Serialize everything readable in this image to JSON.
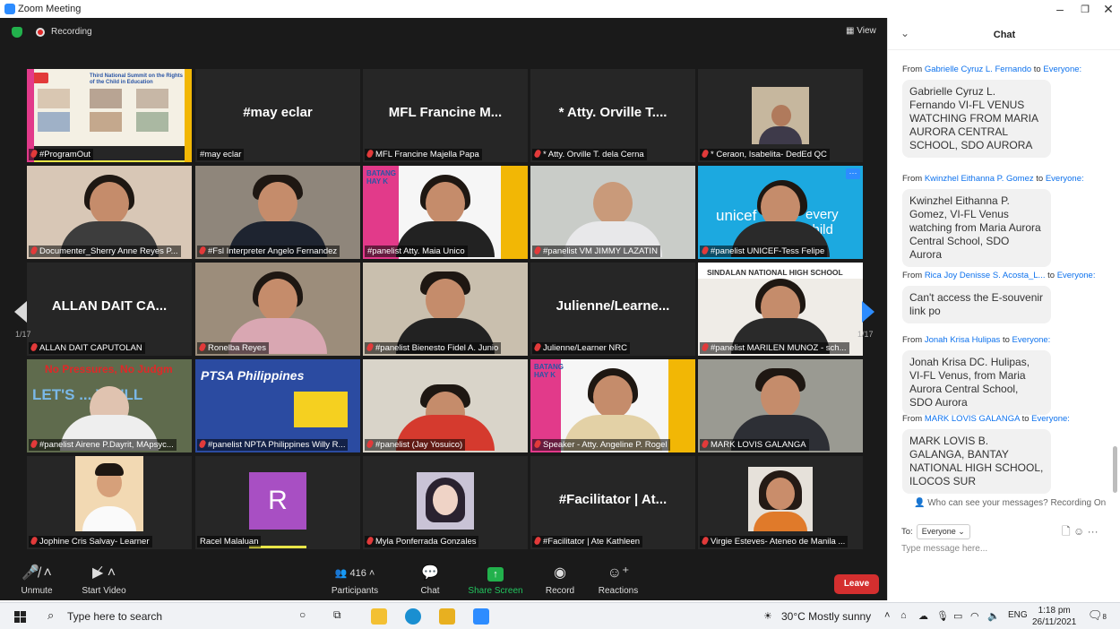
{
  "window": {
    "title": "Zoom Meeting"
  },
  "topbar": {
    "recording": "Recording",
    "view": "View"
  },
  "tiles": [
    {
      "label": "#ProgramOut",
      "name": ""
    },
    {
      "label": "#may eclar",
      "name": "#may eclar"
    },
    {
      "label": "MFL Francine Majella Papa",
      "name": "MFL Francine M..."
    },
    {
      "label": "* Atty. Orville T. dela Cerna",
      "name": "* Atty. Orville T...."
    },
    {
      "label": "* Ceraon, Isabelita- DedEd QC",
      "name": ""
    },
    {
      "label": "Documenter_Sherry Anne Reyes P...",
      "name": ""
    },
    {
      "label": "#Fsl Interpreter Angelo Fernandez",
      "name": ""
    },
    {
      "label": "#panelist Atty. Maia Unico",
      "name": ""
    },
    {
      "label": "#panelist VM JIMMY LAZATIN",
      "name": ""
    },
    {
      "label": "#panelist UNICEF-Tess Felipe",
      "name": ""
    },
    {
      "label": "ALLAN DAIT CAPUTOLAN",
      "name": "ALLAN DAIT CA..."
    },
    {
      "label": "Ronelba Reyes",
      "name": ""
    },
    {
      "label": "#panelist Bienesto Fidel A. Junio",
      "name": ""
    },
    {
      "label": "Julienne/Learner NRC",
      "name": "Julienne/Learne..."
    },
    {
      "label": "#panelist MARILEN MUNOZ - sch...",
      "name": ""
    },
    {
      "label": "#panelist Airene P.Dayrit, MApsyc...",
      "name": ""
    },
    {
      "label": "#panelist NPTA Philippines Willy R...",
      "name": ""
    },
    {
      "label": "#panelist (Jay Yosuico)",
      "name": ""
    },
    {
      "label": "Speaker - Atty. Angeline P. Rogel",
      "name": ""
    },
    {
      "label": "MARK LOVIS GALANGA",
      "name": ""
    },
    {
      "label": "Jophine Cris Salvay- Learner",
      "name": ""
    },
    {
      "label": "Racel Malaluan",
      "name": ""
    },
    {
      "label": "Myla Ponferrada Gonzales",
      "name": ""
    },
    {
      "label": "#Facilitator | Ate Kathleen",
      "name": "#Facilitator | At..."
    },
    {
      "label": "Virgie Esteves- Ateneo de Manila ...",
      "name": ""
    }
  ],
  "tile_texts": {
    "summit": "Third National Summit on the Rights of the Child in Education",
    "batang": "BATANG HAY K",
    "unicef": "unicef",
    "unicef_tail": "every child",
    "sindalan": "SINDALAN NATIONAL HIGH SCHOOL",
    "nopressure": "No Pressures, No Judgm",
    "lets": "LET'S ... WE'LL",
    "ptsa": "PTSA Philippines",
    "avatar_letter": "R"
  },
  "pager": {
    "left": "1/17",
    "right": "1/17"
  },
  "toolbar": {
    "unmute": "Unmute",
    "start_video": "Start Video",
    "participants": "Participants",
    "participants_count": "416",
    "chat": "Chat",
    "share": "Share Screen",
    "record": "Record",
    "reactions": "Reactions",
    "leave": "Leave"
  },
  "chat": {
    "title": "Chat",
    "messages": [
      {
        "from": "Gabrielle Cyruz L. Fernando",
        "to": "Everyone:",
        "text": "Gabrielle Cyruz L. Fernando VI-FL VENUS WATCHING FROM MARIA AURORA CENTRAL SCHOOL, SDO AURORA"
      },
      {
        "from": "Kwinzhel Eithanna P. Gomez",
        "to": "Everyone:",
        "text": "Kwinzhel Eithanna P. Gomez, VI-FL Venus watching from Maria Aurora Central School, SDO Aurora"
      },
      {
        "from": "Rica Joy Denisse S. Acosta_L...",
        "to": "Everyone:",
        "text": "Can't access the E-souvenir link po"
      },
      {
        "from": "Jonah Krisa Hulipas",
        "to": "Everyone:",
        "text": "Jonah Krisa DC. Hulipas, VI-FL Venus, from Maria Aurora Central School, SDO Aurora"
      },
      {
        "from": "MARK LOVIS GALANGA",
        "to": "Everyone:",
        "text": "MARK LOVIS B. GALANGA, BANTAY NATIONAL HIGH SCHOOL, ILOCOS SUR"
      }
    ],
    "from_word": "From",
    "to_word": "to",
    "who_can_see": "Who can see your messages? Recording On",
    "to_label": "To:",
    "to_value": "Everyone",
    "input_placeholder": "Type message here..."
  },
  "taskbar": {
    "search_placeholder": "Type here to search",
    "weather": "30°C  Mostly sunny",
    "lang": "ENG",
    "time": "1:18 pm",
    "date": "26/11/2021",
    "notif_count": "8"
  }
}
